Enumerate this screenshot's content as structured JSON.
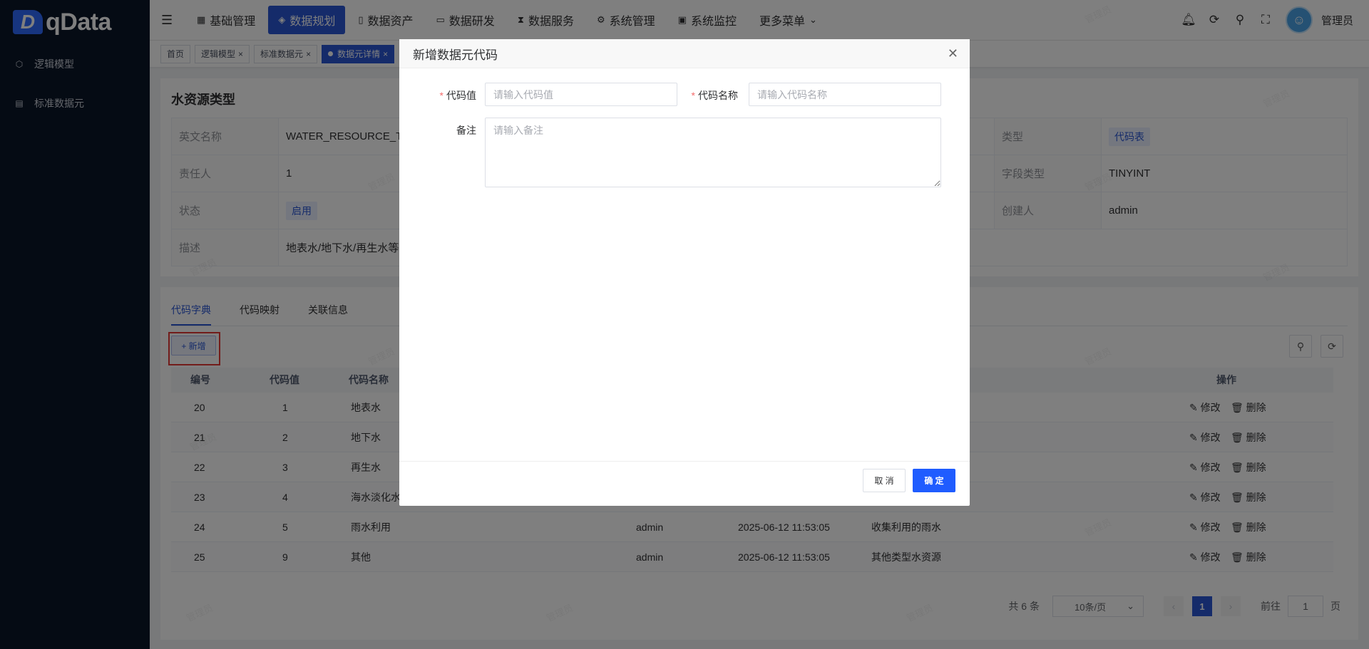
{
  "app": {
    "logo_mark": "D",
    "logo_text": "qData"
  },
  "sidebar": {
    "items": [
      {
        "label": "逻辑模型",
        "icon": "model-icon"
      },
      {
        "label": "标准数据元",
        "icon": "book-icon"
      }
    ]
  },
  "topbar": {
    "menus": [
      {
        "label": "基础管理",
        "icon": "grid-icon"
      },
      {
        "label": "数据规划",
        "icon": "layers-icon",
        "active": true
      },
      {
        "label": "数据资产",
        "icon": "file-icon"
      },
      {
        "label": "数据研发",
        "icon": "box-icon"
      },
      {
        "label": "数据服务",
        "icon": "hourglass-icon"
      },
      {
        "label": "系统管理",
        "icon": "gear-icon"
      },
      {
        "label": "系统监控",
        "icon": "monitor-icon"
      },
      {
        "label": "更多菜单",
        "icon": "chevron-down-icon"
      }
    ],
    "user": "管理员"
  },
  "tabs": [
    {
      "label": "首页"
    },
    {
      "label": "逻辑模型"
    },
    {
      "label": "标准数据元"
    },
    {
      "label": "数据元详情",
      "active": true
    }
  ],
  "detail": {
    "title": "水资源类型",
    "rows": [
      {
        "l1": "英文名称",
        "v1": "WATER_RESOURCE_T",
        "l2": "类型",
        "v2": "代码表"
      },
      {
        "l1": "责任人",
        "v1": "1",
        "l2": "字段类型",
        "v2": "TINYINT"
      },
      {
        "l1": "状态",
        "v1": "启用",
        "l2": "创建人",
        "v2": "admin"
      },
      {
        "l1": "描述",
        "v1": "地表水/地下水/再生水等",
        "l2": "",
        "v2": ""
      }
    ]
  },
  "code_tabs": [
    "代码字典",
    "代码映射",
    "关联信息"
  ],
  "add_button": "+ 新增",
  "table": {
    "headers": {
      "id": "编号",
      "value": "代码值",
      "name": "代码名称",
      "ops": "操作"
    },
    "rows": [
      {
        "id": "20",
        "value": "1",
        "name": "地表水",
        "creator": "",
        "time": "",
        "remark": ""
      },
      {
        "id": "21",
        "value": "2",
        "name": "地下水",
        "creator": "",
        "time": "",
        "remark": ""
      },
      {
        "id": "22",
        "value": "3",
        "name": "再生水",
        "creator": "",
        "time": "",
        "remark": ""
      },
      {
        "id": "23",
        "value": "4",
        "name": "海水淡化水",
        "creator": "",
        "time": "",
        "remark": ""
      },
      {
        "id": "24",
        "value": "5",
        "name": "雨水利用",
        "creator": "admin",
        "time": "2025-06-12 11:53:05",
        "remark": "收集利用的雨水"
      },
      {
        "id": "25",
        "value": "9",
        "name": "其他",
        "creator": "admin",
        "time": "2025-06-12 11:53:05",
        "remark": "其他类型水资源"
      }
    ],
    "edit_label": "修改",
    "delete_label": "删除"
  },
  "pager": {
    "total": "共 6 条",
    "page_size": "10条/页",
    "current": "1",
    "goto_prefix": "前往",
    "goto_value": "1",
    "goto_suffix": "页"
  },
  "watermark": "管理员",
  "dialog": {
    "title": "新增数据元代码",
    "code_value_label": "代码值",
    "code_value_placeholder": "请输入代码值",
    "code_name_label": "代码名称",
    "code_name_placeholder": "请输入代码名称",
    "remark_label": "备注",
    "remark_placeholder": "请输入备注",
    "cancel": "取 消",
    "confirm": "确 定"
  }
}
